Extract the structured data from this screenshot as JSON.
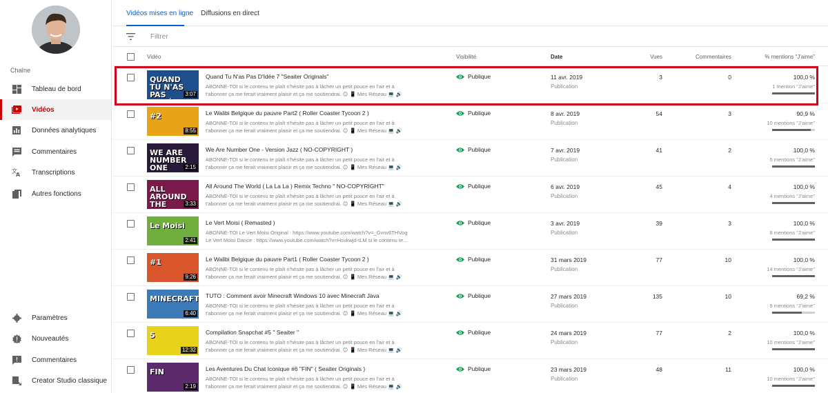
{
  "sidebar": {
    "section_label": "Chaîne",
    "items": [
      {
        "label": "Tableau de bord",
        "icon": "dashboard-icon"
      },
      {
        "label": "Vidéos",
        "icon": "video-icon"
      },
      {
        "label": "Données analytiques",
        "icon": "analytics-icon"
      },
      {
        "label": "Commentaires",
        "icon": "comment-icon"
      },
      {
        "label": "Transcriptions",
        "icon": "translate-icon"
      },
      {
        "label": "Autres fonctions",
        "icon": "copy-icon"
      }
    ],
    "bottom_items": [
      {
        "label": "Paramètres",
        "icon": "gear-icon"
      },
      {
        "label": "Nouveautés",
        "icon": "alert-icon"
      },
      {
        "label": "Commentaires",
        "icon": "feedback-icon"
      },
      {
        "label": "Creator Studio classique",
        "icon": "classic-icon"
      }
    ]
  },
  "tabs": [
    {
      "label": "Vidéos mises en ligne"
    },
    {
      "label": "Diffusions en direct"
    }
  ],
  "filter": {
    "placeholder": "Filtrer"
  },
  "columns": {
    "video": "Vidéo",
    "visibility": "Visibilité",
    "date": "Date",
    "views": "Vues",
    "comments": "Commentaires",
    "likes": "% mentions \"J'aime\""
  },
  "videos": [
    {
      "title": "Quand Tu N'as Pas D'Idée 7 \"Seaiter Originals\"",
      "desc": "ABONNE-TOI si le contenu te plaît n'hésite pas à lâcher un petit pouce en l'air et à\nt'abonner ça me ferait vraiment plaisir et ça me soutiendrai. 😊 📱 Mes Réseau 💻 🔊",
      "duration": "3:07",
      "thumb_text": "QUAND\nTU N'AS\nPAS\nD'IDÉE",
      "visibility": "Publique",
      "date": "11 avr. 2019",
      "date_sub": "Publication",
      "views": "3",
      "comments": "0",
      "like_pct": "100,0 %",
      "like_count": "1 mention \"J'aime\"",
      "ratio": 1.0,
      "thumb_color": "#1e4f8c"
    },
    {
      "title": "Le Walibi Belgique du pauvre Part2 ( Roller Coaster Tycoon 2 )",
      "desc": "ABONNE-TOI si le contenu te plaît n'hésite pas à lâcher un petit pouce en l'air et à\nt'abonner ça me ferait vraiment plaisir et ça me soutiendrai. 😊 📱 Mes Réseau 💻 🔊",
      "duration": "8:55",
      "thumb_text": "#2",
      "visibility": "Publique",
      "date": "8 avr. 2019",
      "date_sub": "Publication",
      "views": "54",
      "comments": "3",
      "like_pct": "90,9 %",
      "like_count": "10 mentions \"J'aime\"",
      "ratio": 0.909,
      "thumb_color": "#e8a317"
    },
    {
      "title": "We Are Number One - Version Jazz ( NO-COPYRIGHT )",
      "desc": "ABONNE-TOI si le contenu te plaît n'hésite pas à lâcher un petit pouce en l'air et à\nt'abonner ça me ferait vraiment plaisir et ça me soutiendrai. 😊 📱 Mes Réseau 💻 🔊",
      "duration": "2:15",
      "thumb_text": "WE ARE\nNUMBER ONE",
      "visibility": "Publique",
      "date": "7 avr. 2019",
      "date_sub": "Publication",
      "views": "41",
      "comments": "2",
      "like_pct": "100,0 %",
      "like_count": "5 mentions \"J'aime\"",
      "ratio": 1.0,
      "thumb_color": "#2a1a3a"
    },
    {
      "title": "All Around The World ( La La La ) Remix Techno \" NO-COPYRIGHT\"",
      "desc": "ABONNE-TOI si le contenu te plaît n'hésite pas à lâcher un petit pouce en l'air et à\nt'abonner ça me ferait vraiment plaisir et ça me soutiendrai. 😊 📱 Mes Réseau 💻 🔊",
      "duration": "3:33",
      "thumb_text": "ALL AROUND THE\nWORLD ( LA LA )",
      "visibility": "Publique",
      "date": "6 avr. 2019",
      "date_sub": "Publication",
      "views": "45",
      "comments": "4",
      "like_pct": "100,0 %",
      "like_count": "4 mentions \"J'aime\"",
      "ratio": 1.0,
      "thumb_color": "#7a1a4a"
    },
    {
      "title": "Le Vert Moisi ( Remasted )",
      "desc": "ABONNE-TOI Le Vert Moisi Original : https://www.youtube.com/watch?v=_Gvnv6THVog\nLe Vert Moisi Dance : https://www.youtube.com/watch?v=Hsvkwjd-tLM si le contenu te...",
      "duration": "2:41",
      "thumb_text": "Le   Moisi",
      "visibility": "Publique",
      "date": "3 avr. 2019",
      "date_sub": "Publication",
      "views": "39",
      "comments": "3",
      "like_pct": "100,0 %",
      "like_count": "8 mentions \"J'aime\"",
      "ratio": 1.0,
      "thumb_color": "#6fae3f"
    },
    {
      "title": "Le Walibi Belgique du pauvre Part1 ( Roller Coaster Tycoon 2 )",
      "desc": "ABONNE-TOI si le contenu te plaît n'hésite pas à lâcher un petit pouce en l'air et à\nt'abonner ça me ferait vraiment plaisir et ça me soutiendrai. 😊 📱 Mes Réseau 💻 🔊",
      "duration": "9:26",
      "thumb_text": "#1",
      "visibility": "Publique",
      "date": "31 mars 2019",
      "date_sub": "Publication",
      "views": "77",
      "comments": "10",
      "like_pct": "100,0 %",
      "like_count": "14 mentions \"J'aime\"",
      "ratio": 1.0,
      "thumb_color": "#d9552b"
    },
    {
      "title": "TUTO : Comment avoir Minecraft Windows 10 avec Minecraft Java",
      "desc": "ABONNE-TOI si le contenu te plaît n'hésite pas à lâcher un petit pouce en l'air et à\nt'abonner ça me ferait vraiment plaisir et ça me soutiendrai. 😊 📱 Mes Réseau 💻 🔊",
      "duration": "6:40",
      "thumb_text": "MINECRAFT",
      "visibility": "Publique",
      "date": "27 mars 2019",
      "date_sub": "Publication",
      "views": "135",
      "comments": "10",
      "like_pct": "69,2 %",
      "like_count": "9 mentions \"J'aime\"",
      "ratio": 0.692,
      "thumb_color": "#3d7ab8"
    },
    {
      "title": "Compilation Snapchat #5 \" Seaiter \"",
      "desc": "ABONNE-TOI si le contenu te plaît n'hésite pas à lâcher un petit pouce en l'air et à\nt'abonner ça me ferait vraiment plaisir et ça me soutiendrai. 😊 📱 Mes Réseau 💻 🔊",
      "duration": "12:32",
      "thumb_text": "5",
      "visibility": "Publique",
      "date": "24 mars 2019",
      "date_sub": "Publication",
      "views": "77",
      "comments": "2",
      "like_pct": "100,0 %",
      "like_count": "10 mentions \"J'aime\"",
      "ratio": 1.0,
      "thumb_color": "#e8d21a"
    },
    {
      "title": "Les Aventures Du Chat Iconique #6 \"FIN\" ( Seaiter Originals )",
      "desc": "ABONNE-TOI si le contenu te plaît n'hésite pas à lâcher un petit pouce en l'air et à\nt'abonner ça me ferait vraiment plaisir et ça me soutiendrai. 😊 📱 Mes Réseau 💻 🔊",
      "duration": "2:19",
      "thumb_text": "FIN",
      "visibility": "Publique",
      "date": "23 mars 2019",
      "date_sub": "Publication",
      "views": "48",
      "comments": "11",
      "like_pct": "100,0 %",
      "like_count": "10 mentions \"J'aime\"",
      "ratio": 1.0,
      "thumb_color": "#5a2a6a"
    }
  ]
}
